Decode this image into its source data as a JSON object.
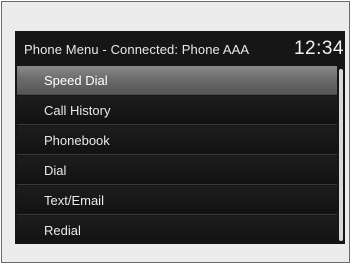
{
  "header": {
    "title": "Phone Menu - Connected: Phone AAA",
    "clock": "12:34"
  },
  "menu": {
    "selected_index": 0,
    "items": [
      {
        "label": "Speed Dial"
      },
      {
        "label": "Call History"
      },
      {
        "label": "Phonebook"
      },
      {
        "label": "Dial"
      },
      {
        "label": "Text/Email"
      },
      {
        "label": "Redial"
      }
    ]
  },
  "scrollbar": {
    "visible_fraction": 1.0
  },
  "colors": {
    "background": "#161616",
    "highlight": "#7a7a7a",
    "text": "#e9e9e9"
  }
}
